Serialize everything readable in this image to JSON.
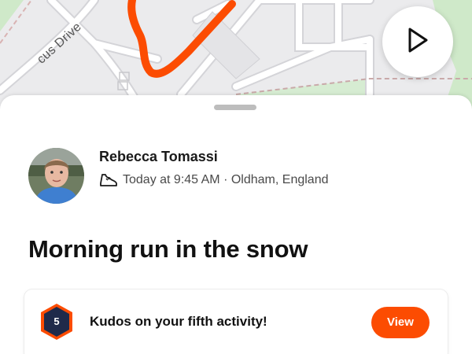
{
  "map": {
    "street_label": "cus Drive",
    "route_color": "#fc4c02"
  },
  "controls": {
    "play_icon": "play-icon"
  },
  "activity": {
    "athlete_name": "Rebecca Tomassi",
    "sport_icon": "running-shoe-icon",
    "meta": "Today at 9:45 AM · Oldham, England",
    "title": "Morning run in the snow"
  },
  "kudos_card": {
    "badge_number": "5",
    "text": "Kudos on your fifth activity!",
    "button_label": "View",
    "accent_color": "#fc4c02"
  }
}
